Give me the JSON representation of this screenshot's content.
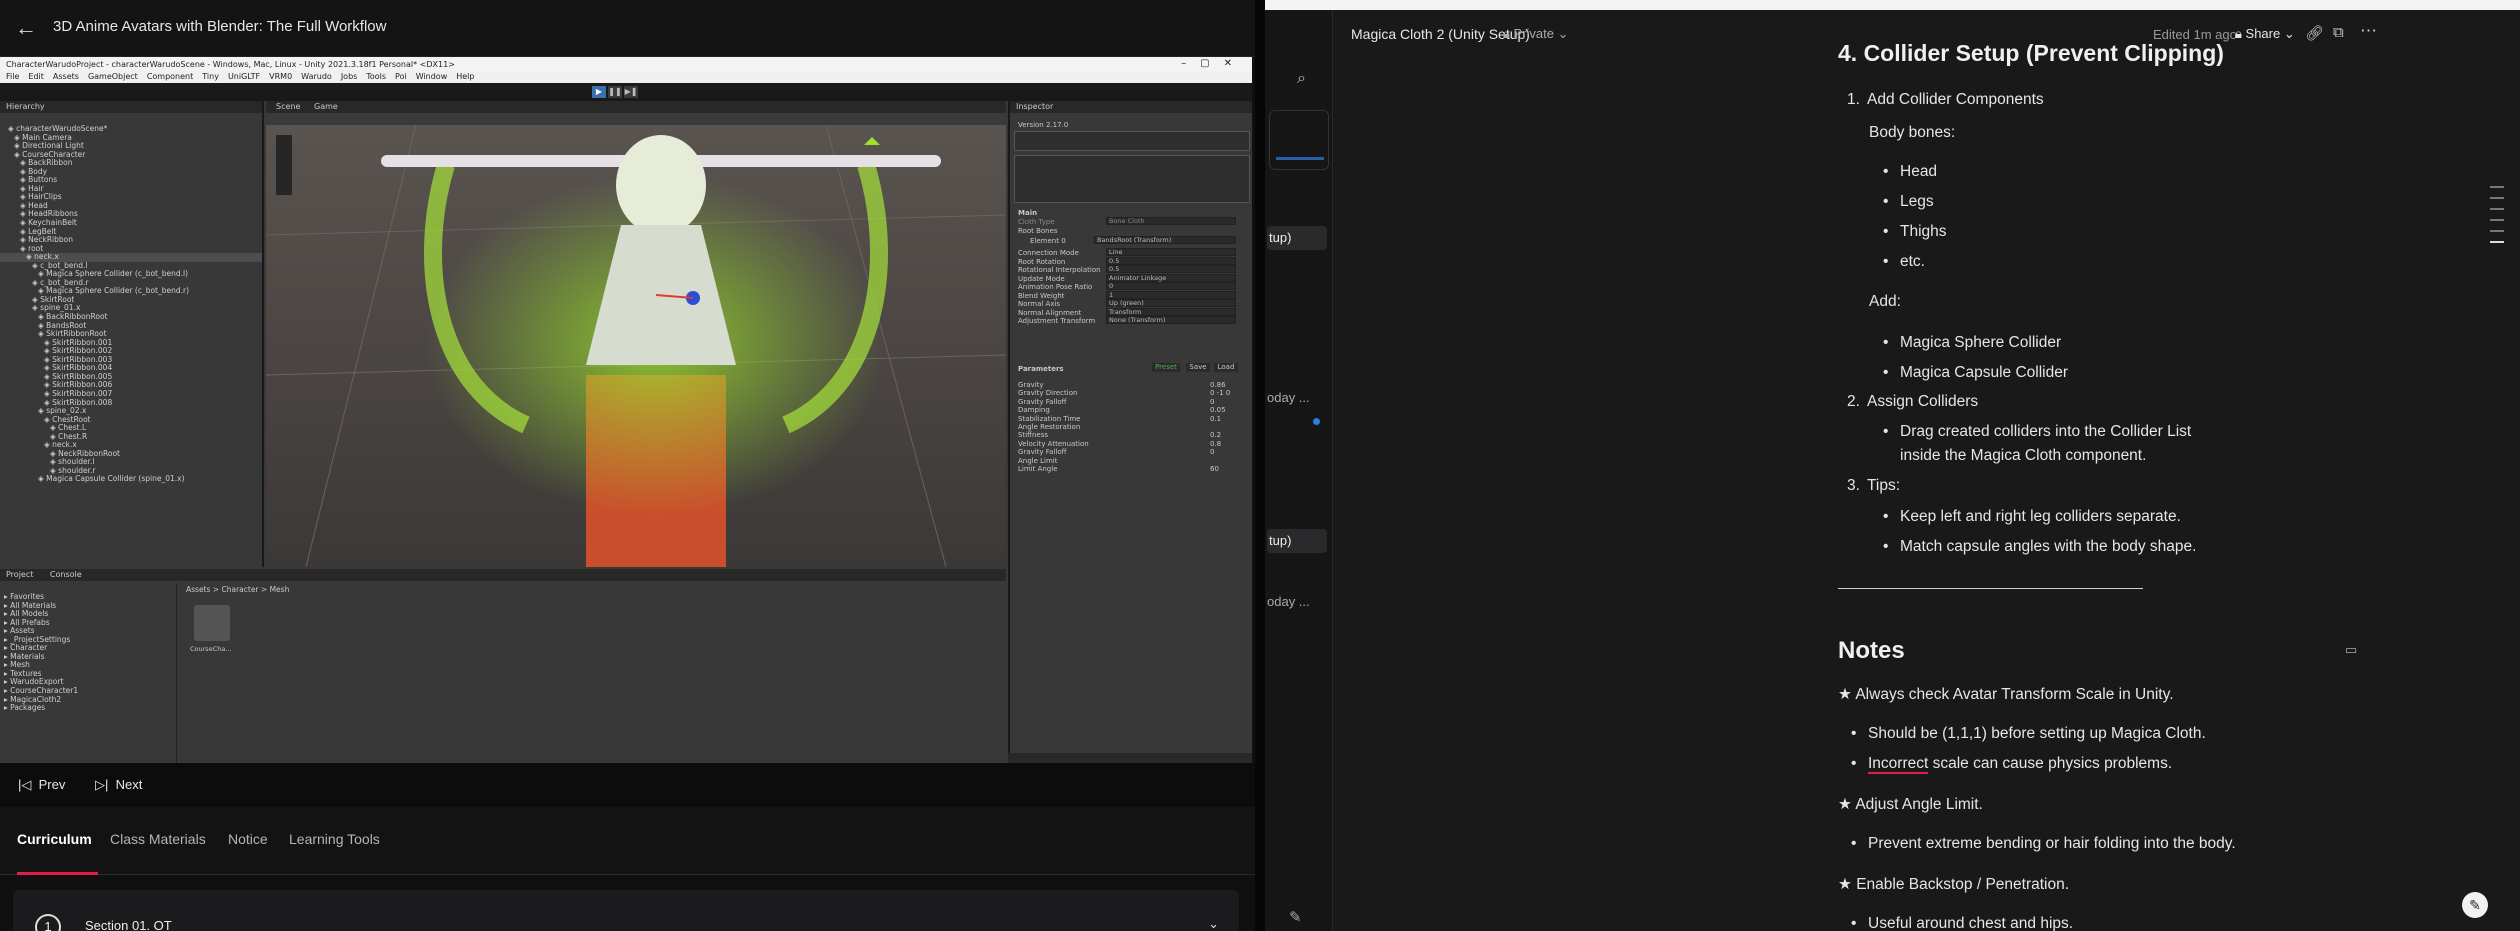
{
  "course": {
    "title": "3D Anime Avatars with Blender: The Full Workflow",
    "prev_label": "Prev",
    "next_label": "Next",
    "tabs": [
      "Curriculum",
      "Class Materials",
      "Notice",
      "Learning Tools"
    ],
    "active_tab": "Curriculum",
    "section_number": "1",
    "section_label": "Section 01. OT"
  },
  "unity": {
    "window_title": "CharacterWarudoProject - characterWarudoScene - Windows, Mac, Linux - Unity 2021.3.18f1 Personal* <DX11>",
    "menu": [
      "File",
      "Edit",
      "Assets",
      "GameObject",
      "Component",
      "Tiny",
      "UniGLTF",
      "VRM0",
      "Warudo",
      "Jobs",
      "Tools",
      "Poi",
      "Window",
      "Help"
    ],
    "hierarchy_tab": "Hierarchy",
    "hierarchy_items": [
      "characterWarudoScene*",
      "Main Camera",
      "Directional Light",
      "CourseCharacter",
      "BackRibbon",
      "Body",
      "Buttons",
      "Hair",
      "HairClips",
      "Head",
      "HeadRibbons",
      "KeychainBelt",
      "LegBelt",
      "NeckRibbon",
      "root",
      "neck.x",
      "c_bot_bend.l",
      "Magica Sphere Collider (c_bot_bend.l)",
      "c_bot_bend.r",
      "Magica Sphere Collider (c_bot_bend.r)",
      "SkirtRoot",
      "spine_01.x",
      "BackRibbonRoot",
      "BandsRoot",
      "SkirtRibbonRoot",
      "SkirtRibbon.001",
      "SkirtRibbon.002",
      "SkirtRibbon.003",
      "SkirtRibbon.004",
      "SkirtRibbon.005",
      "SkirtRibbon.006",
      "SkirtRibbon.007",
      "SkirtRibbon.008",
      "spine_02.x",
      "ChestRoot",
      "Chest.L",
      "Chest.R",
      "neck.x",
      "NeckRibbonRoot",
      "shoulder.l",
      "shoulder.r",
      "Magica Capsule Collider (spine_01.x)"
    ],
    "scene_tabs": [
      "Scene",
      "Game"
    ],
    "inspector_tab": "Inspector",
    "inspector": {
      "version": "Version 2.17.0",
      "main_label": "Main",
      "cloth_type_label": "Cloth Type",
      "cloth_type": "Bone Cloth",
      "root_bones_label": "Root Bones",
      "element0_label": "Element 0",
      "element0_value": "BandsRoot (Transform)",
      "rows": [
        {
          "label": "Connection Mode",
          "value": "Line"
        },
        {
          "label": "Root Rotation",
          "value": "0.5"
        },
        {
          "label": "Rotational Interpolation",
          "value": "0.5"
        },
        {
          "label": "Update Mode",
          "value": "Animator Linkage"
        },
        {
          "label": "Animation Pose Ratio",
          "value": "0"
        },
        {
          "label": "Blend Weight",
          "value": "1"
        },
        {
          "label": "Normal Axis",
          "value": "Up (green)"
        },
        {
          "label": "Normal Alignment",
          "value": "Transform"
        },
        {
          "label": "Adjustment Transform",
          "value": "None (Transform)"
        }
      ],
      "parameters_label": "Parameters",
      "preset_label": "Preset",
      "save_label": "Save",
      "load_label": "Load",
      "params": [
        {
          "label": "Gravity",
          "value": "0.86"
        },
        {
          "label": "Gravity Direction",
          "value": "0   -1   0"
        },
        {
          "label": "Gravity Falloff",
          "value": "0"
        },
        {
          "label": "Damping",
          "value": "0.05"
        },
        {
          "label": "Stabilization Time",
          "value": "0.1"
        },
        {
          "label": "Angle Restoration",
          "value": ""
        },
        {
          "label": "Stiffness",
          "value": "0.2"
        },
        {
          "label": "Velocity Attenuation",
          "value": "0.8"
        },
        {
          "label": "Gravity Falloff",
          "value": "0"
        },
        {
          "label": "Angle Limit",
          "value": ""
        },
        {
          "label": "Limit Angle",
          "value": "60"
        }
      ]
    },
    "project_tab": "Project",
    "console_tab": "Console",
    "project_tree": [
      "Favorites",
      "All Materials",
      "All Models",
      "All Prefabs",
      "Assets",
      "_ProjectSettings",
      "Character",
      "Materials",
      "Mesh",
      "Textures",
      "WarudoExport",
      "CourseCharacter1",
      "MagicaCloth2",
      "Packages"
    ],
    "breadcrumb": [
      "Assets",
      "Character",
      "Mesh"
    ],
    "asset_name": "CourseCha..."
  },
  "doc": {
    "title": "Magica Cloth 2 (Unity Setup)",
    "privacy": "Private",
    "edited": "Edited 1m ago",
    "share_label": "Share",
    "heading_collider": "4. Collider Setup (Prevent Clipping)",
    "item1_num": "1.",
    "item1": "Add Collider Components",
    "body_bones_label": "Body bones:",
    "body_bones": [
      "Head",
      "Legs",
      "Thighs",
      "etc."
    ],
    "add_label": "Add:",
    "add_items": [
      "Magica Sphere Collider",
      "Magica Capsule Collider"
    ],
    "item2_num": "2.",
    "item2": "Assign Colliders",
    "item2_sub_line1": "Drag created colliders into the Collider List",
    "item2_sub_line2": "inside the Magica Cloth component.",
    "item3_num": "3.",
    "item3": "Tips:",
    "tips": [
      "Keep left and right leg colliders separate.",
      "Match capsule angles with the body shape."
    ],
    "notes_heading": "Notes",
    "note1": "★ Always check Avatar Transform Scale in Unity.",
    "note1_bullets": [
      "Should be (1,1,1) before setting up Magica Cloth."
    ],
    "note1_b2_word": "Incorrect",
    "note1_b2_rest": " scale can cause physics problems.",
    "note2": "★ Adjust Angle Limit.",
    "note2_bullets": [
      "Prevent extreme bending or hair folding into the body."
    ],
    "note3": "★ Enable Backstop / Penetration.",
    "note3_bullets": [
      "Useful around chest and hips."
    ],
    "sidebar_peek": [
      "tup)",
      "oday ...",
      "tup)",
      "oday ..."
    ]
  },
  "colors": {
    "accent_red": "#e11d48",
    "unity_green": "#4caf50",
    "notion_bg": "#19191a"
  }
}
